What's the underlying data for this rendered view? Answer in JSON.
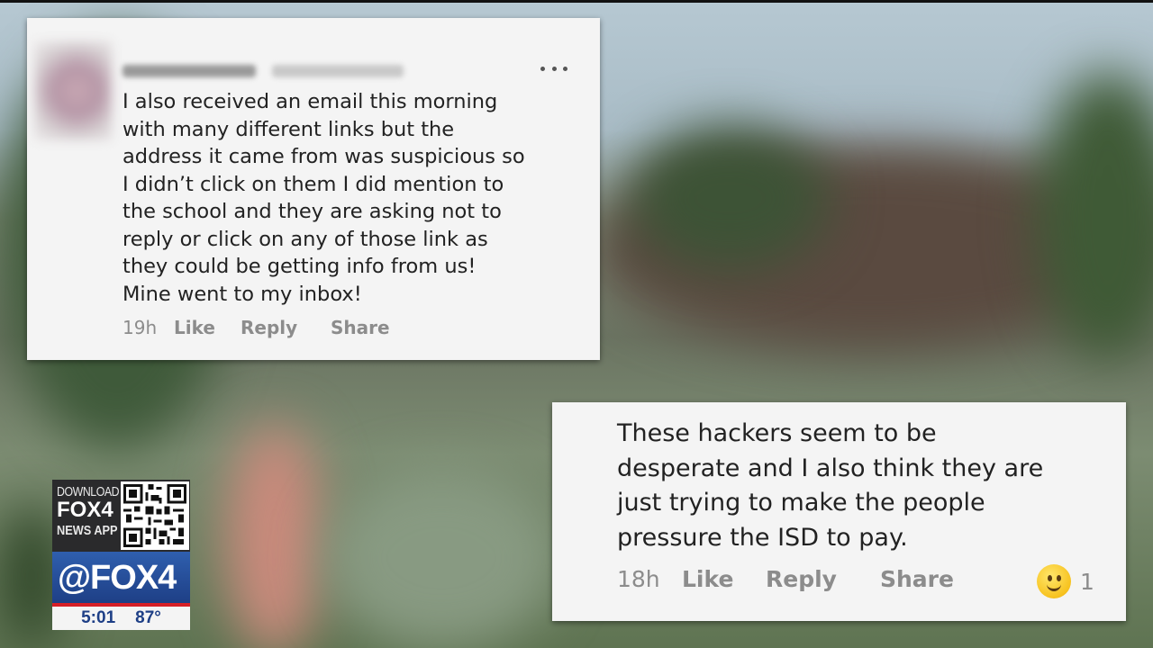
{
  "comments": [
    {
      "body_lines": [
        "I also received an email this morning",
        "with many different links but the",
        "address it came from was suspicious so",
        "I didn’t click on them I did mention to",
        "the school and they are asking not to",
        "reply or click on any of those link as",
        "they could be getting info from us!",
        "Mine went to my inbox!"
      ],
      "time": "19h",
      "like_label": "Like",
      "reply_label": "Reply",
      "share_label": "Share",
      "menu_icon": "more-dots-icon"
    },
    {
      "body_lines": [
        "These hackers seem to be",
        "desperate and I also think they are",
        "just trying to make the people",
        "pressure the ISD to pay."
      ],
      "time": "18h",
      "like_label": "Like",
      "reply_label": "Reply",
      "share_label": "Share",
      "reaction_icon": "smiley-emoji-icon",
      "reaction_count": "1"
    }
  ],
  "station_bug": {
    "download_line1": "DOWNLOAD",
    "download_line2": "FOX4",
    "download_line3": "NEWS APP",
    "handle": "@FOX4",
    "time": "5:01",
    "temperature": "87°",
    "brand_blue": "#1e3f86",
    "brand_red": "#d61f26"
  }
}
